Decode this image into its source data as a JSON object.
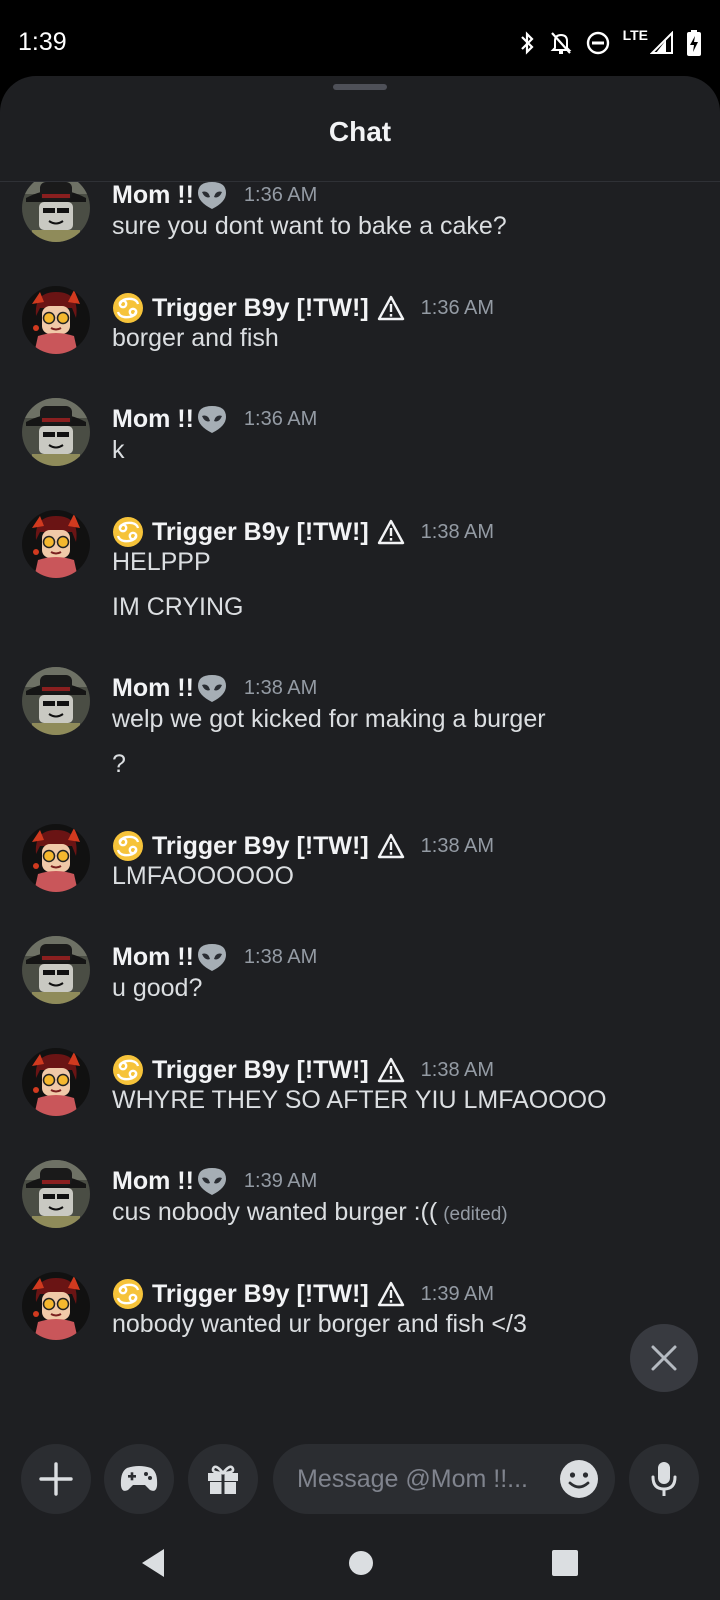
{
  "status_bar": {
    "time": "1:39",
    "network": "LTE"
  },
  "sheet": {
    "title": "Chat"
  },
  "messages": [
    {
      "author": "Mom !!",
      "author_emoji": "alien",
      "time": "1:36 AM",
      "lines": [
        "sure you dont want to bake a cake?"
      ]
    },
    {
      "author": "Trigger B9y [!TW!]",
      "author_prefix": "cancer-zodiac",
      "author_suffix": "warning",
      "time": "1:36 AM",
      "lines": [
        "borger and fish"
      ]
    },
    {
      "author": "Mom !!",
      "author_emoji": "alien",
      "time": "1:36 AM",
      "lines": [
        "k"
      ]
    },
    {
      "author": "Trigger B9y [!TW!]",
      "author_prefix": "cancer-zodiac",
      "author_suffix": "warning",
      "time": "1:38 AM",
      "lines": [
        "HELPPP",
        "IM CRYING"
      ]
    },
    {
      "author": "Mom !!",
      "author_emoji": "alien",
      "time": "1:38 AM",
      "lines": [
        "welp we got kicked for making a burger",
        "?"
      ]
    },
    {
      "author": "Trigger B9y [!TW!]",
      "author_prefix": "cancer-zodiac",
      "author_suffix": "warning",
      "time": "1:38 AM",
      "lines": [
        "LMFAOOOOOO"
      ]
    },
    {
      "author": "Mom !!",
      "author_emoji": "alien",
      "time": "1:38 AM",
      "lines": [
        "u good?"
      ]
    },
    {
      "author": "Trigger B9y [!TW!]",
      "author_prefix": "cancer-zodiac",
      "author_suffix": "warning",
      "time": "1:38 AM",
      "lines": [
        "WHYRE THEY SO AFTER YIU LMFAOOOO"
      ]
    },
    {
      "author": "Mom !!",
      "author_emoji": "alien",
      "time": "1:39 AM",
      "lines": [
        "cus nobody wanted burger :(("
      ],
      "edited_label": "(edited)"
    },
    {
      "author": "Trigger B9y [!TW!]",
      "author_prefix": "cancer-zodiac",
      "author_suffix": "warning",
      "time": "1:39 AM",
      "lines": [
        "nobody wanted ur borger and fish </3"
      ]
    }
  ],
  "composer": {
    "placeholder": "Message @Mom !!...",
    "buttons": [
      "plus-icon",
      "gamepad-icon",
      "gift-icon",
      "emoji-icon",
      "microphone-icon"
    ]
  },
  "colors": {
    "background": "#1e1f22",
    "surface": "#2b2d31",
    "text_primary": "#f2f3f5",
    "text_muted": "#949ba4"
  }
}
